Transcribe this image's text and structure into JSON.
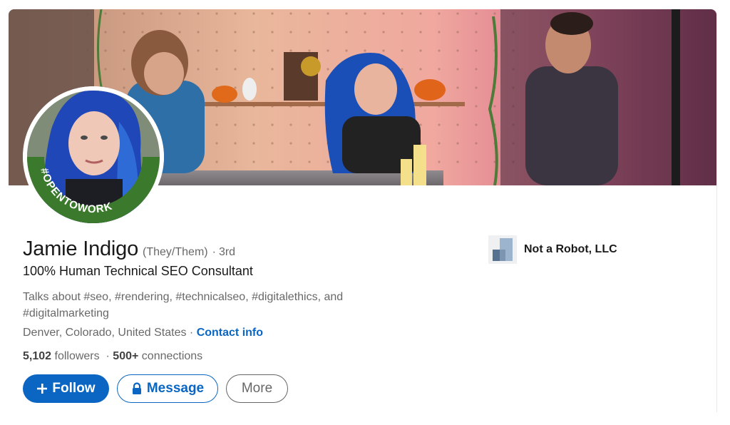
{
  "profile": {
    "name": "Jamie Indigo",
    "pronouns": "(They/Them)",
    "degree_separator": "·",
    "degree": "3rd",
    "headline": "100% Human Technical SEO Consultant",
    "talks_about": "Talks about #seo, #rendering, #technicalseo, #digitalethics, and #digitalmarketing",
    "location": "Denver, Colorado, United States",
    "location_separator": " · ",
    "contact_info_label": "Contact info",
    "followers_count": "5,102",
    "followers_label": " followers",
    "stats_separator": "  · ",
    "connections_count": "500+",
    "connections_label": " connections",
    "open_to_work_badge": "#OPENTOWORK"
  },
  "actions": {
    "follow_label": "Follow",
    "follow_icon": "plus-icon",
    "message_label": "Message",
    "message_icon": "lock-icon",
    "more_label": "More"
  },
  "company": {
    "name": "Not a Robot, LLC",
    "logo_icon": "company-building-icon"
  },
  "colors": {
    "brand_blue": "#0a66c2",
    "open_to_work_green": "#3b7a2c",
    "secondary_text": "rgba(0,0,0,0.6)"
  }
}
